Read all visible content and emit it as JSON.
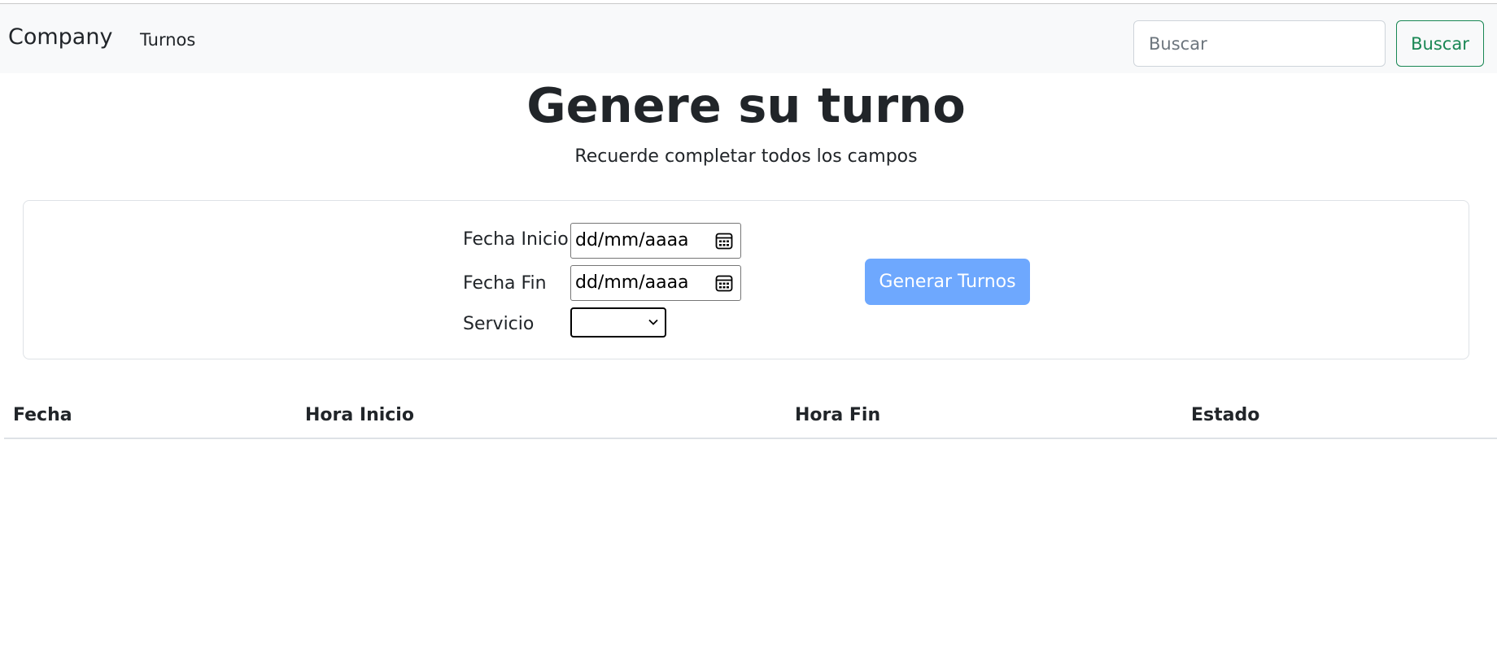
{
  "navbar": {
    "brand": "Company",
    "links": [
      {
        "label": "Turnos"
      }
    ],
    "search": {
      "placeholder": "Buscar",
      "value": "",
      "button_label": "Buscar"
    }
  },
  "header": {
    "title": "Genere su turno",
    "subtitle": "Recuerde completar todos los campos"
  },
  "form": {
    "fecha_inicio": {
      "label": "Fecha Inicio:",
      "placeholder": "dd/mm/aaaa"
    },
    "fecha_fin": {
      "label": "Fecha Fin",
      "placeholder": "dd/mm/aaaa"
    },
    "servicio": {
      "label": "Servicio",
      "selected": ""
    },
    "generate_label": "Generar Turnos"
  },
  "table": {
    "columns": [
      "Fecha",
      "Hora Inicio",
      "Hora Fin",
      "Estado"
    ],
    "rows": []
  },
  "colors": {
    "navbar_bg": "#f8f9fa",
    "success": "#198754",
    "primary_disabled": "#6ea8fe"
  }
}
